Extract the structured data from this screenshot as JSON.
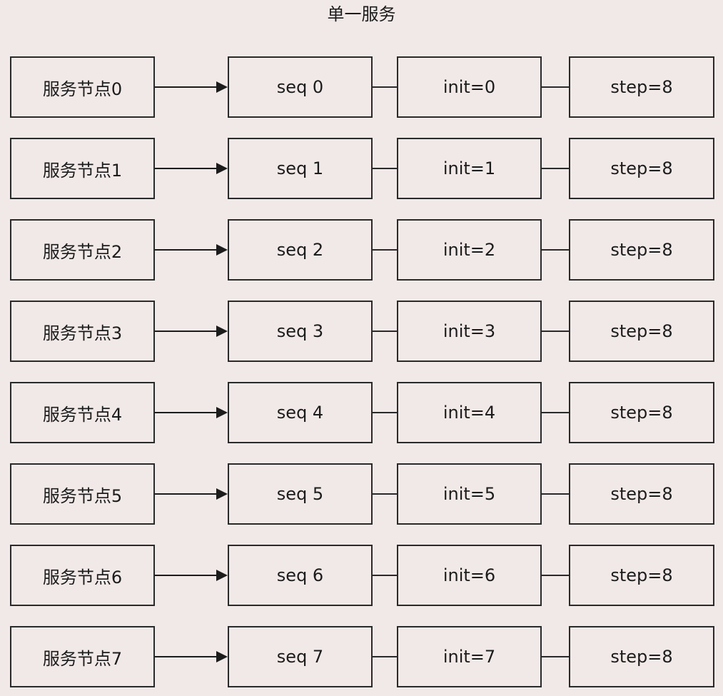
{
  "title": "单一服务",
  "rows": [
    {
      "node": "服务节点0",
      "seq": "seq 0",
      "init": "init=0",
      "step": "step=8"
    },
    {
      "node": "服务节点1",
      "seq": "seq 1",
      "init": "init=1",
      "step": "step=8"
    },
    {
      "node": "服务节点2",
      "seq": "seq 2",
      "init": "init=2",
      "step": "step=8"
    },
    {
      "node": "服务节点3",
      "seq": "seq 3",
      "init": "init=3",
      "step": "step=8"
    },
    {
      "node": "服务节点4",
      "seq": "seq 4",
      "init": "init=4",
      "step": "step=8"
    },
    {
      "node": "服务节点5",
      "seq": "seq 5",
      "init": "init=5",
      "step": "step=8"
    },
    {
      "node": "服务节点6",
      "seq": "seq 6",
      "init": "init=6",
      "step": "step=8"
    },
    {
      "node": "服务节点7",
      "seq": "seq 7",
      "init": "init=7",
      "step": "step=8"
    }
  ]
}
